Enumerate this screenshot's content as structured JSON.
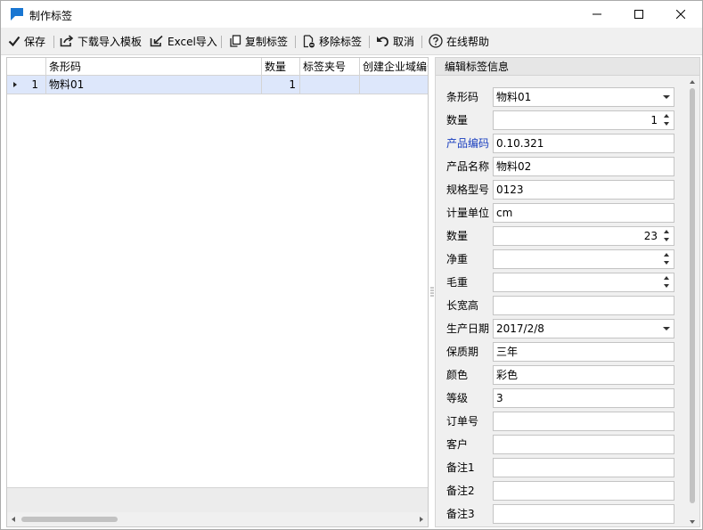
{
  "window": {
    "title": "制作标签"
  },
  "toolbar": {
    "save": "保存",
    "download_template": "下载导入模板",
    "excel_import": "Excel导入",
    "copy_label": "复制标签",
    "remove_label": "移除标签",
    "cancel": "取消",
    "help": "在线帮助"
  },
  "grid": {
    "columns": [
      "条形码",
      "数量",
      "标签夹号",
      "创建企业域编号"
    ],
    "rows": [
      {
        "index": "1",
        "barcode": "物料01",
        "qty": "1",
        "folder": "",
        "domain": ""
      }
    ]
  },
  "panel": {
    "title": "编辑标签信息",
    "fields": [
      {
        "label": "条形码",
        "value": "物料01"
      },
      {
        "label": "数量",
        "value": "1"
      },
      {
        "label": "产品编码",
        "value": "0.10.321"
      },
      {
        "label": "产品名称",
        "value": "物料02"
      },
      {
        "label": "规格型号",
        "value": "0123"
      },
      {
        "label": "计量单位",
        "value": "cm"
      },
      {
        "label": "数量",
        "value": "23"
      },
      {
        "label": "净重",
        "value": ""
      },
      {
        "label": "毛重",
        "value": ""
      },
      {
        "label": "长宽高",
        "value": ""
      },
      {
        "label": "生产日期",
        "value": "2017/2/8"
      },
      {
        "label": "保质期",
        "value": "三年"
      },
      {
        "label": "颜色",
        "value": "彩色"
      },
      {
        "label": "等级",
        "value": "3"
      },
      {
        "label": "订单号",
        "value": ""
      },
      {
        "label": "客户",
        "value": ""
      },
      {
        "label": "备注1",
        "value": ""
      },
      {
        "label": "备注2",
        "value": ""
      },
      {
        "label": "备注3",
        "value": ""
      }
    ]
  },
  "colors": {
    "accent_blue": "#1a3fbf",
    "selected_row": "#dde7fb",
    "app_icon": "#1976d2"
  },
  "icons": {
    "app": "app-logo-icon",
    "minimize": "minimize-icon",
    "maximize": "maximize-icon",
    "close": "close-icon",
    "save": "checkmark-icon",
    "download": "export-icon",
    "excel": "import-icon",
    "copy": "copy-icon",
    "remove": "remove-document-icon",
    "cancel": "undo-icon",
    "help": "help-icon"
  }
}
